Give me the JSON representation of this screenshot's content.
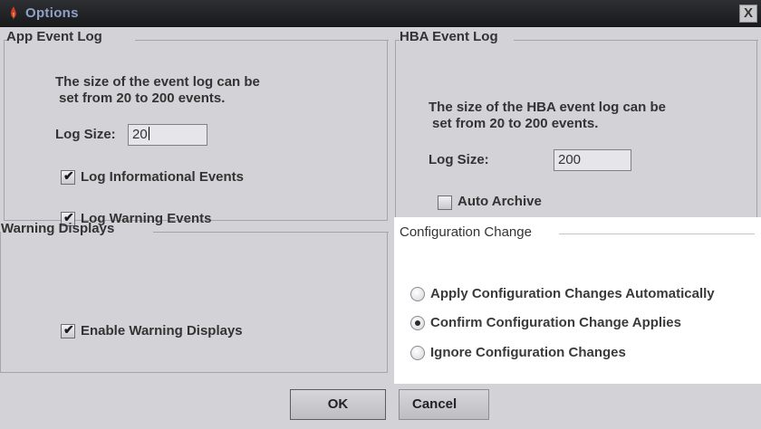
{
  "window": {
    "title": "Options",
    "close_label": "X"
  },
  "app_event_log": {
    "title": "App Event Log",
    "description_line1": "The size of the event log can be",
    "description_line2": "set from 20 to 200 events.",
    "log_size_label": "Log Size:",
    "log_size_value": "20",
    "log_informational": {
      "label": "Log Informational Events",
      "checked": true
    },
    "log_warning": {
      "label": "Log Warning Events",
      "checked": true
    }
  },
  "hba_event_log": {
    "title": "HBA Event Log",
    "description_line1": "The size of the HBA event log can be",
    "description_line2": "set from 20 to 200 events.",
    "log_size_label": "Log Size:",
    "log_size_value": "200",
    "auto_archive": {
      "label": "Auto Archive",
      "checked": false
    }
  },
  "warning_displays": {
    "title": "Warning Displays",
    "enable": {
      "label": "Enable Warning Displays",
      "checked": true
    }
  },
  "configuration_change": {
    "title": "Configuration Change",
    "options": [
      {
        "label": "Apply Configuration Changes Automatically",
        "selected": false
      },
      {
        "label": "Confirm Configuration Change Applies",
        "selected": true
      },
      {
        "label": "Ignore Configuration Changes",
        "selected": false
      }
    ]
  },
  "buttons": {
    "ok_label": "OK",
    "cancel_label": "Cancel"
  }
}
